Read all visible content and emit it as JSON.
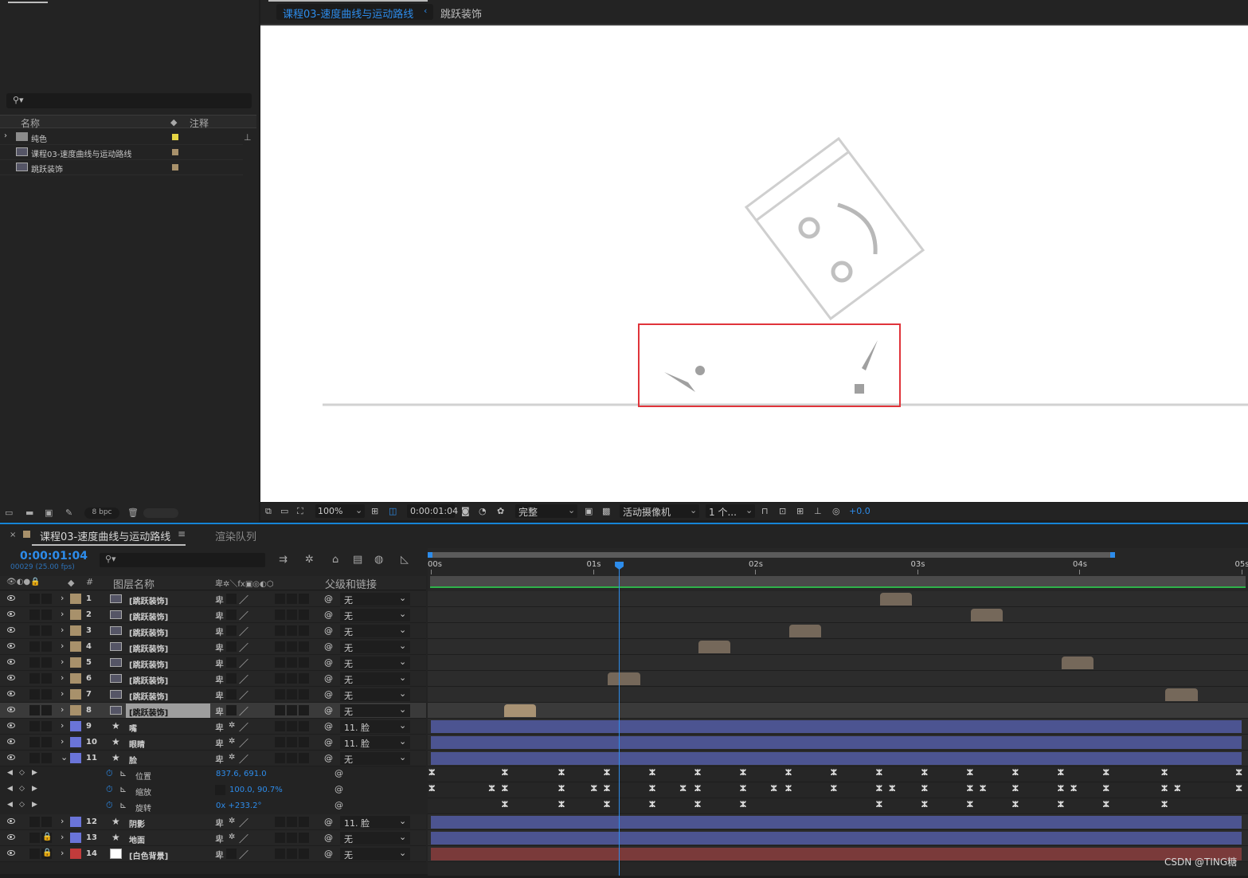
{
  "project": {
    "search_placeholder": "",
    "col_name": "名称",
    "col_comment": "注释",
    "items": [
      {
        "name": "纯色",
        "type": "folder",
        "label_color": "#e5d544"
      },
      {
        "name": "课程03-速度曲线与运动路线",
        "type": "comp",
        "label_color": "#a8916b"
      },
      {
        "name": "跳跃装饰",
        "type": "comp",
        "label_color": "#a8916b"
      }
    ],
    "bpc": "8 bpc"
  },
  "viewer": {
    "tabs": [
      "课程03-速度曲线与运动路线",
      "跳跃装饰"
    ],
    "zoom": "100%",
    "timecode": "0:00:01:04",
    "resolution": "完整",
    "camera": "活动摄像机",
    "views": "1 个...",
    "exposure": "+0.0"
  },
  "timeline": {
    "tabs": [
      "课程03-速度曲线与运动路线",
      "渲染队列"
    ],
    "current_time": "0:00:01:04",
    "frame_info": "00029 (25.00 fps)",
    "col_layer_name": "图层名称",
    "col_parent": "父级和链接",
    "col_num": "#",
    "ruler": [
      "00s",
      "01s",
      "02s",
      "03s",
      "04s",
      "05s"
    ],
    "layers": [
      {
        "num": "1",
        "name": "[跳跃装饰]",
        "color": "#a8916b",
        "type": "comp",
        "parent": "无",
        "bar_start_s": 2.77,
        "bar_end_s": 2.97
      },
      {
        "num": "2",
        "name": "[跳跃装饰]",
        "color": "#a8916b",
        "type": "comp",
        "parent": "无",
        "bar_start_s": 3.33,
        "bar_end_s": 3.53
      },
      {
        "num": "3",
        "name": "[跳跃装饰]",
        "color": "#a8916b",
        "type": "comp",
        "parent": "无",
        "bar_start_s": 2.21,
        "bar_end_s": 2.41
      },
      {
        "num": "4",
        "name": "[跳跃装饰]",
        "color": "#a8916b",
        "type": "comp",
        "parent": "无",
        "bar_start_s": 1.65,
        "bar_end_s": 1.85
      },
      {
        "num": "5",
        "name": "[跳跃装饰]",
        "color": "#a8916b",
        "type": "comp",
        "parent": "无",
        "bar_start_s": 3.89,
        "bar_end_s": 4.09
      },
      {
        "num": "6",
        "name": "[跳跃装饰]",
        "color": "#a8916b",
        "type": "comp",
        "parent": "无",
        "bar_start_s": 1.09,
        "bar_end_s": 1.29
      },
      {
        "num": "7",
        "name": "[跳跃装饰]",
        "color": "#a8916b",
        "type": "comp",
        "parent": "无",
        "bar_start_s": 4.53,
        "bar_end_s": 4.73
      },
      {
        "num": "8",
        "name": "[跳跃装饰]",
        "color": "#a8916b",
        "type": "comp",
        "parent": "无",
        "bar_start_s": 0.45,
        "bar_end_s": 0.65,
        "selected": true
      },
      {
        "num": "9",
        "name": "嘴",
        "color": "#6a74d8",
        "type": "shape",
        "parent": "11. 脸",
        "bar_start_s": 0.0,
        "bar_end_s": 5.0
      },
      {
        "num": "10",
        "name": "眼睛",
        "color": "#6a74d8",
        "type": "shape",
        "parent": "11. 脸",
        "bar_start_s": 0.0,
        "bar_end_s": 5.0
      },
      {
        "num": "11",
        "name": "脸",
        "color": "#6a74d8",
        "type": "shape",
        "parent": "无",
        "bar_start_s": 0.0,
        "bar_end_s": 5.0,
        "expanded": true
      },
      {
        "num": "12",
        "name": "阴影",
        "color": "#6a74d8",
        "type": "shape",
        "parent": "11. 脸",
        "bar_start_s": 0.0,
        "bar_end_s": 5.0
      },
      {
        "num": "13",
        "name": "地面",
        "color": "#6a74d8",
        "type": "shape",
        "parent": "无",
        "bar_start_s": 0.0,
        "bar_end_s": 5.0,
        "locked": true
      },
      {
        "num": "14",
        "name": "[白色背景]",
        "color": "#c23b3b",
        "type": "solid",
        "parent": "无",
        "bar_start_s": 0.0,
        "bar_end_s": 5.0,
        "locked": true
      }
    ],
    "properties": [
      {
        "name": "位置",
        "value": "837.6, 691.0"
      },
      {
        "name": "缩放",
        "value": "100.0, 90.7%"
      },
      {
        "name": "旋转",
        "value": "0x +233.2°"
      }
    ],
    "playhead_s": 1.16
  },
  "watermark": "CSDN @TING糖"
}
